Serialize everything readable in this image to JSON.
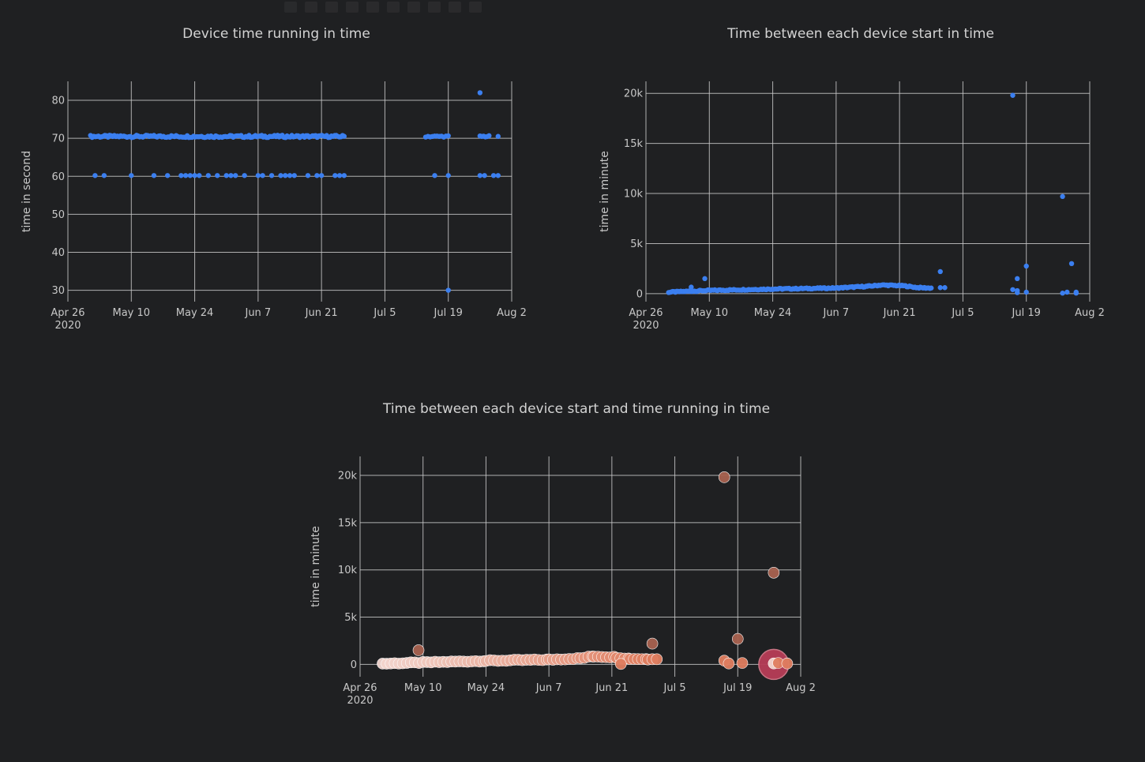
{
  "colors": {
    "background": "#1f2022",
    "grid": "#c9c9c9",
    "tick_text": "#c8c8c8",
    "title_text": "#d3d3d3",
    "marker_blue": "#3b7ff0",
    "bubble_light": "#f3d6cf",
    "bubble_mid": "#e07e60",
    "bubble_dark": "#a76250",
    "bubble_large": "#b73d57"
  },
  "chart_data": [
    {
      "id": "running",
      "type": "scatter",
      "title": "Device time running in time",
      "xlabel": "",
      "ylabel": "time in second",
      "x_range": [
        "2020-04-26",
        "2020-08-02"
      ],
      "x_ticks": [
        {
          "date": "2020-04-26",
          "label": "Apr 26",
          "sub": "2020"
        },
        {
          "date": "2020-05-10",
          "label": "May 10"
        },
        {
          "date": "2020-05-24",
          "label": "May 24"
        },
        {
          "date": "2020-06-07",
          "label": "Jun 7"
        },
        {
          "date": "2020-06-21",
          "label": "Jun 21"
        },
        {
          "date": "2020-07-05",
          "label": "Jul 5"
        },
        {
          "date": "2020-07-19",
          "label": "Jul 19"
        },
        {
          "date": "2020-08-02",
          "label": "Aug 2"
        }
      ],
      "ylim": [
        27,
        85
      ],
      "y_ticks": [
        {
          "value": 30,
          "label": "30"
        },
        {
          "value": 40,
          "label": "40"
        },
        {
          "value": 50,
          "label": "50"
        },
        {
          "value": 60,
          "label": "60"
        },
        {
          "value": 70,
          "label": "70"
        },
        {
          "value": 80,
          "label": "80"
        }
      ],
      "grid": true,
      "series": [
        {
          "color": "#3b7ff0",
          "groups": [
            {
              "from": "2020-05-01",
              "to": "2020-06-26",
              "step": 0.35,
              "y": 70.5,
              "jitter": 0.3
            },
            {
              "from": "2020-07-14",
              "to": "2020-07-19",
              "step": 0.5,
              "y": 70.5,
              "jitter": 0.2
            },
            {
              "from": "2020-07-26",
              "to": "2020-07-28",
              "step": 0.4,
              "y": 70.5,
              "jitter": 0.2
            }
          ],
          "points": [
            {
              "x": "2020-07-30",
              "y": 70.5
            },
            {
              "x": "2020-07-26",
              "y": 82
            },
            {
              "x": "2020-07-19",
              "y": 30
            },
            {
              "x": "2020-05-02",
              "y": 60.2
            },
            {
              "x": "2020-05-04",
              "y": 60.2
            },
            {
              "x": "2020-05-10",
              "y": 60.2
            },
            {
              "x": "2020-05-15",
              "y": 60.2
            },
            {
              "x": "2020-05-18",
              "y": 60.2
            },
            {
              "x": "2020-05-21",
              "y": 60.2
            },
            {
              "x": "2020-05-22",
              "y": 60.2
            },
            {
              "x": "2020-05-23",
              "y": 60.2
            },
            {
              "x": "2020-05-24",
              "y": 60.2
            },
            {
              "x": "2020-05-25",
              "y": 60.2
            },
            {
              "x": "2020-05-27",
              "y": 60.2
            },
            {
              "x": "2020-05-29",
              "y": 60.2
            },
            {
              "x": "2020-05-31",
              "y": 60.2
            },
            {
              "x": "2020-06-01",
              "y": 60.2
            },
            {
              "x": "2020-06-02",
              "y": 60.2
            },
            {
              "x": "2020-06-04",
              "y": 60.2
            },
            {
              "x": "2020-06-07",
              "y": 60.2
            },
            {
              "x": "2020-06-08",
              "y": 60.2
            },
            {
              "x": "2020-06-10",
              "y": 60.2
            },
            {
              "x": "2020-06-12",
              "y": 60.2
            },
            {
              "x": "2020-06-13",
              "y": 60.2
            },
            {
              "x": "2020-06-14",
              "y": 60.2
            },
            {
              "x": "2020-06-15",
              "y": 60.2
            },
            {
              "x": "2020-06-18",
              "y": 60.2
            },
            {
              "x": "2020-06-20",
              "y": 60.2
            },
            {
              "x": "2020-06-21",
              "y": 60.2
            },
            {
              "x": "2020-06-24",
              "y": 60.2
            },
            {
              "x": "2020-06-25",
              "y": 60.2
            },
            {
              "x": "2020-06-26",
              "y": 60.2
            },
            {
              "x": "2020-07-16",
              "y": 60.2
            },
            {
              "x": "2020-07-19",
              "y": 60.2
            },
            {
              "x": "2020-07-26",
              "y": 60.2
            },
            {
              "x": "2020-07-27",
              "y": 60.2
            },
            {
              "x": "2020-07-29",
              "y": 60.2
            },
            {
              "x": "2020-07-30",
              "y": 60.2
            }
          ]
        }
      ]
    },
    {
      "id": "between",
      "type": "scatter",
      "title": "Time between each device start in time",
      "xlabel": "",
      "ylabel": "time in minute",
      "x_range": [
        "2020-04-26",
        "2020-08-02"
      ],
      "x_ticks": [
        {
          "date": "2020-04-26",
          "label": "Apr 26",
          "sub": "2020"
        },
        {
          "date": "2020-05-10",
          "label": "May 10"
        },
        {
          "date": "2020-05-24",
          "label": "May 24"
        },
        {
          "date": "2020-06-07",
          "label": "Jun 7"
        },
        {
          "date": "2020-06-21",
          "label": "Jun 21"
        },
        {
          "date": "2020-07-05",
          "label": "Jul 5"
        },
        {
          "date": "2020-07-19",
          "label": "Jul 19"
        },
        {
          "date": "2020-08-02",
          "label": "Aug 2"
        }
      ],
      "ylim": [
        -800,
        21200
      ],
      "y_ticks": [
        {
          "value": 0,
          "label": "0"
        },
        {
          "value": 5000,
          "label": "5k"
        },
        {
          "value": 10000,
          "label": "10k"
        },
        {
          "value": 15000,
          "label": "15k"
        },
        {
          "value": 20000,
          "label": "20k"
        }
      ],
      "grid": true,
      "series": [
        {
          "color": "#3b7ff0",
          "trend": [
            {
              "x": "2020-05-01",
              "y": 150
            },
            {
              "x": "2020-05-10",
              "y": 320
            },
            {
              "x": "2020-05-24",
              "y": 460
            },
            {
              "x": "2020-06-07",
              "y": 560
            },
            {
              "x": "2020-06-14",
              "y": 730
            },
            {
              "x": "2020-06-17",
              "y": 860
            },
            {
              "x": "2020-06-22",
              "y": 780
            },
            {
              "x": "2020-06-25",
              "y": 600
            },
            {
              "x": "2020-06-28",
              "y": 560
            }
          ],
          "trend_step": 0.3,
          "points": [
            {
              "x": "2020-05-06",
              "y": 650
            },
            {
              "x": "2020-05-09",
              "y": 1500
            },
            {
              "x": "2020-06-30",
              "y": 2200
            },
            {
              "x": "2020-06-30",
              "y": 600
            },
            {
              "x": "2020-07-01",
              "y": 600
            },
            {
              "x": "2020-07-16",
              "y": 19800
            },
            {
              "x": "2020-07-16",
              "y": 400
            },
            {
              "x": "2020-07-17",
              "y": 1500
            },
            {
              "x": "2020-07-17",
              "y": 300
            },
            {
              "x": "2020-07-17",
              "y": 100
            },
            {
              "x": "2020-07-19",
              "y": 2750
            },
            {
              "x": "2020-07-19",
              "y": 150
            },
            {
              "x": "2020-07-27",
              "y": 9700
            },
            {
              "x": "2020-07-27",
              "y": 50
            },
            {
              "x": "2020-07-28",
              "y": 150
            },
            {
              "x": "2020-07-29",
              "y": 3000
            },
            {
              "x": "2020-07-30",
              "y": 150
            },
            {
              "x": "2020-07-30",
              "y": 50
            }
          ]
        }
      ]
    },
    {
      "id": "bubble",
      "type": "scatter",
      "title": "Time between each device start and time running in time",
      "xlabel": "",
      "ylabel": "time in minute",
      "x_range": [
        "2020-04-26",
        "2020-08-02"
      ],
      "x_ticks": [
        {
          "date": "2020-04-26",
          "label": "Apr 26",
          "sub": "2020"
        },
        {
          "date": "2020-05-10",
          "label": "May 10"
        },
        {
          "date": "2020-05-24",
          "label": "May 24"
        },
        {
          "date": "2020-06-07",
          "label": "Jun 7"
        },
        {
          "date": "2020-06-21",
          "label": "Jun 21"
        },
        {
          "date": "2020-07-05",
          "label": "Jul 5"
        },
        {
          "date": "2020-07-19",
          "label": "Jul 19"
        },
        {
          "date": "2020-08-02",
          "label": "Aug 2"
        }
      ],
      "ylim": [
        -1300,
        22000
      ],
      "y_ticks": [
        {
          "value": 0,
          "label": "0"
        },
        {
          "value": 5000,
          "label": "5k"
        },
        {
          "value": 10000,
          "label": "10k"
        },
        {
          "value": 15000,
          "label": "15k"
        },
        {
          "value": 20000,
          "label": "20k"
        }
      ],
      "grid": true,
      "series": [
        {
          "trend": [
            {
              "x": "2020-05-01",
              "y": 80
            },
            {
              "x": "2020-05-10",
              "y": 200
            },
            {
              "x": "2020-05-24",
              "y": 380
            },
            {
              "x": "2020-06-07",
              "y": 500
            },
            {
              "x": "2020-06-14",
              "y": 650
            },
            {
              "x": "2020-06-17",
              "y": 860
            },
            {
              "x": "2020-06-22",
              "y": 760
            },
            {
              "x": "2020-06-25",
              "y": 600
            },
            {
              "x": "2020-06-29",
              "y": 560
            }
          ],
          "trend_step": 0.9,
          "points": [
            {
              "x": "2020-05-09",
              "y": 1500,
              "size": 1.0,
              "shade": "dark"
            },
            {
              "x": "2020-06-23",
              "y": 50,
              "size": 1.0,
              "shade": "mid"
            },
            {
              "x": "2020-06-30",
              "y": 2200,
              "size": 1.0,
              "shade": "dark"
            },
            {
              "x": "2020-06-30",
              "y": 550,
              "size": 1.0,
              "shade": "mid"
            },
            {
              "x": "2020-07-01",
              "y": 550,
              "size": 1.0,
              "shade": "mid"
            },
            {
              "x": "2020-07-16",
              "y": 19800,
              "size": 1.0,
              "shade": "dark"
            },
            {
              "x": "2020-07-16",
              "y": 400,
              "size": 1.0,
              "shade": "mid"
            },
            {
              "x": "2020-07-17",
              "y": 100,
              "size": 1.0,
              "shade": "mid"
            },
            {
              "x": "2020-07-19",
              "y": 2700,
              "size": 1.0,
              "shade": "dark"
            },
            {
              "x": "2020-07-20",
              "y": 150,
              "size": 1.0,
              "shade": "mid"
            },
            {
              "x": "2020-07-27",
              "y": 9700,
              "size": 1.0,
              "shade": "dark"
            },
            {
              "x": "2020-07-27",
              "y": 0,
              "size": 3.0,
              "shade": "large"
            },
            {
              "x": "2020-07-27",
              "y": 100,
              "size": 1.0,
              "shade": "light"
            },
            {
              "x": "2020-07-28",
              "y": 150,
              "size": 1.0,
              "shade": "mid"
            },
            {
              "x": "2020-07-30",
              "y": 100,
              "size": 1.0,
              "shade": "mid"
            }
          ]
        }
      ]
    }
  ]
}
